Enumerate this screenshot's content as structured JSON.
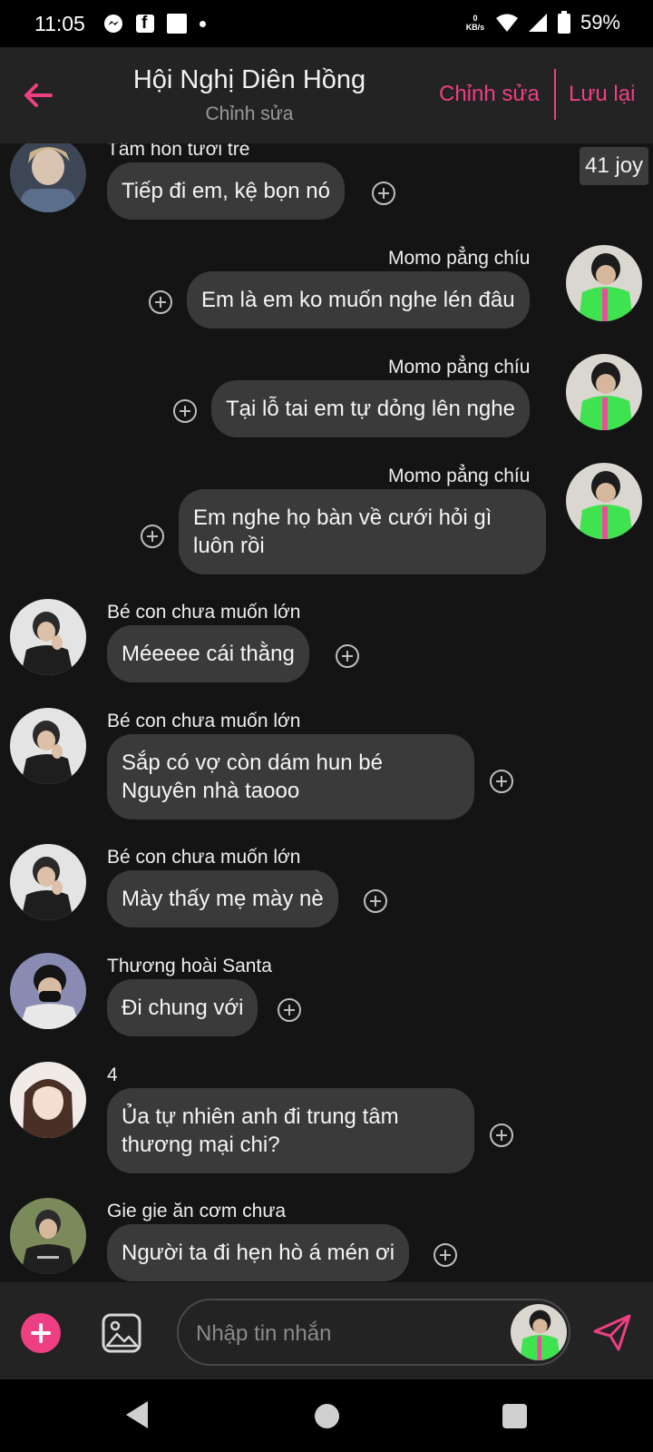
{
  "status_bar": {
    "time": "11:05",
    "net_speed_value": "0",
    "net_speed_unit": "KB/s",
    "battery": "59%"
  },
  "header": {
    "title": "Hội Nghị Diên Hồng",
    "subtitle": "Chỉnh sửa",
    "edit_label": "Chỉnh sửa",
    "save_label": "Lưu lại",
    "accent": "#ee3f83"
  },
  "reaction_badge": "41 joy",
  "messages": [
    {
      "sender": "Tâm hồn tươi tré",
      "text": "Tiếp đi em, kệ bọn nó",
      "side": "left",
      "avatar": "person-denim-jacket"
    },
    {
      "sender": "Momo pẳng chíu",
      "text": "Em là em ko muốn nghe lén đâu",
      "side": "right",
      "avatar": "person-green-shirt"
    },
    {
      "sender": "Momo pẳng chíu",
      "text": "Tại lỗ tai em tự dỏng lên nghe",
      "side": "right",
      "avatar": "person-green-shirt"
    },
    {
      "sender": "Momo pẳng chíu",
      "text": "Em nghe họ bàn về cưới hỏi gì luôn rồi",
      "side": "right",
      "avatar": "person-green-shirt"
    },
    {
      "sender": "Bé con chưa muốn lớn",
      "text": "Méeeee cái thằng",
      "side": "left",
      "avatar": "person-black-shirt"
    },
    {
      "sender": "Bé con chưa muốn lớn",
      "text": "Sắp có vợ còn dám hun bé Nguyên nhà taooo",
      "side": "left",
      "avatar": "person-black-shirt"
    },
    {
      "sender": "Bé con chưa muốn lớn",
      "text": "Mày thấy mẹ mày nè",
      "side": "left",
      "avatar": "person-black-shirt"
    },
    {
      "sender": "Thương hoài Santa",
      "text": "Đi chung với",
      "side": "left",
      "avatar": "person-mask"
    },
    {
      "sender": "4",
      "text": "Ủa tự nhiên anh đi trung tâm thương mại chi?",
      "side": "left",
      "avatar": "person-girl"
    },
    {
      "sender": "Gie gie ăn cơm chưa",
      "text": "Người ta đi hẹn hò á mén ơi",
      "side": "left",
      "avatar": "person-tshirt"
    }
  ],
  "input": {
    "placeholder": "Nhập tin nhắn"
  },
  "icons": {
    "back": "arrow-left-icon",
    "add": "plus-circle-icon",
    "image": "image-icon",
    "send": "send-icon",
    "reaction": "add-reaction-icon"
  }
}
